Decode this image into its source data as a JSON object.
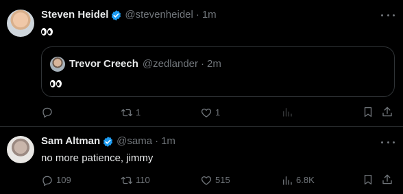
{
  "tweets": [
    {
      "name": "Steven Heidel",
      "handle": "@stevenheidel",
      "dot": "·",
      "time": "1m",
      "quote": {
        "name": "Trevor Creech",
        "handle": "@zedlander",
        "dot": "·",
        "time": "2m"
      },
      "actions": {
        "reply": "",
        "retweet": "1",
        "like": "1",
        "views": ""
      }
    },
    {
      "name": "Sam Altman",
      "handle": "@sama",
      "dot": "·",
      "time": "1m",
      "text": "no more patience, jimmy",
      "actions": {
        "reply": "109",
        "retweet": "110",
        "like": "515",
        "views": "6.8K"
      }
    }
  ],
  "icons": [
    "verified-badge-icon",
    "eyes-emoji",
    "more-icon",
    "reply-icon",
    "retweet-icon",
    "like-icon",
    "views-icon",
    "bookmark-icon",
    "share-icon"
  ],
  "colors": {
    "background": "#000000",
    "text": "#e7e9ea",
    "muted": "#71767b",
    "verified": "#1d9bf0",
    "border": "#2f3336"
  }
}
